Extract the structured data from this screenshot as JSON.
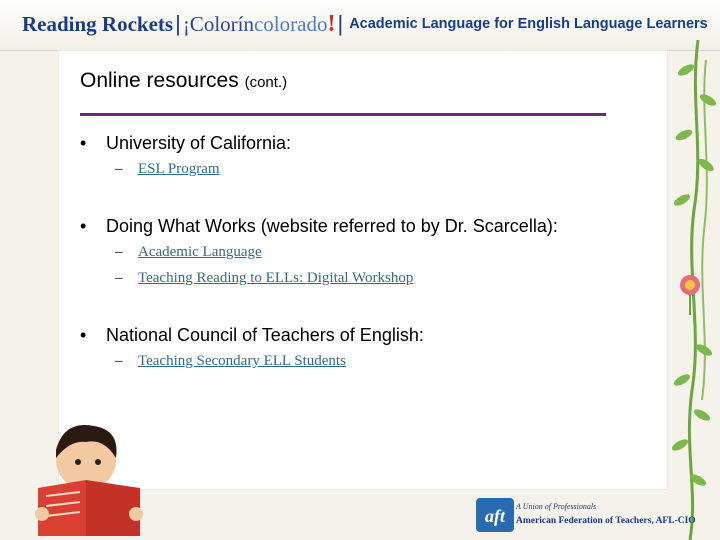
{
  "header": {
    "reading_rockets": "Reading Rockets",
    "separator": "|",
    "colorin_prefix": "¡Colorín",
    "colorado": "colorado",
    "exclaim": "!",
    "separator2": "|",
    "title": "Academic Language for English Language Learners"
  },
  "slide": {
    "title": "Online resources",
    "title_suffix": "(cont.)",
    "bullet_marker": "•",
    "sub_marker": "–",
    "bullets": [
      {
        "text": "University of California:",
        "links": [
          "ESL Program"
        ]
      },
      {
        "text": "Doing What Works (website referred to by Dr. Scarcella):",
        "links": [
          "Academic Language",
          "Teaching Reading to ELLs: Digital Workshop"
        ]
      },
      {
        "text": "National Council of Teachers of English:",
        "links": [
          "Teaching Secondary ELL Students"
        ]
      }
    ]
  },
  "footer": {
    "aft_mark": "aft",
    "aft_tagline": "A Union of Professionals",
    "aft_name": "American Federation of Teachers, AFL-CIO"
  },
  "colors": {
    "header_blue": "#173d85",
    "accent_red": "#d22f1e",
    "title_rule": "#6e2a7a",
    "link": "#2f6c84",
    "vine_green": "#6aa83a"
  },
  "icons": [
    "vine-decoration-icon",
    "flower-icon",
    "child-reading-book-icon",
    "aft-logo-icon"
  ]
}
